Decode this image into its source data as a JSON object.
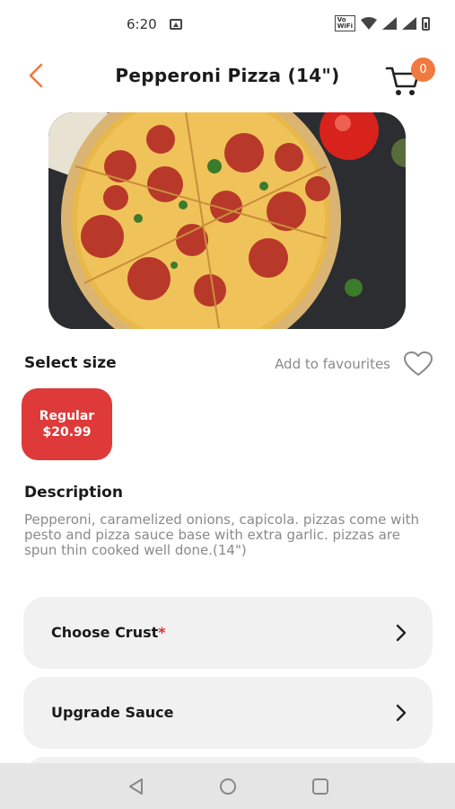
{
  "status_bar": {
    "time": "6:20",
    "volte_top": "Vo",
    "volte_bottom": "WiFi",
    "icons": [
      "image-icon",
      "volte-icon",
      "wifi-icon",
      "signal-icon",
      "battery-icon"
    ]
  },
  "header": {
    "title": "Pepperoni Pizza (14\")",
    "cart_count": "0",
    "accent_color": "#f07a3f"
  },
  "product": {
    "image_name": "pepperoni-pizza-photo"
  },
  "size_section": {
    "label": "Select size",
    "favourite_label": "Add to favourites",
    "sizes": [
      {
        "name": "Regular",
        "price": "$20.99",
        "selected": true,
        "color": "#de3a3a"
      }
    ]
  },
  "description": {
    "title": "Description",
    "text": "Pepperoni, caramelized onions, capicola. pizzas come with pesto and pizza sauce base with extra garlic. pizzas are spun thin cooked well done.(14\")"
  },
  "options": [
    {
      "label": "Choose Crust",
      "required_mark": "*"
    },
    {
      "label": "Upgrade Sauce"
    }
  ],
  "nav": {
    "icons": [
      "back-triangle-icon",
      "home-circle-icon",
      "recents-square-icon"
    ]
  }
}
